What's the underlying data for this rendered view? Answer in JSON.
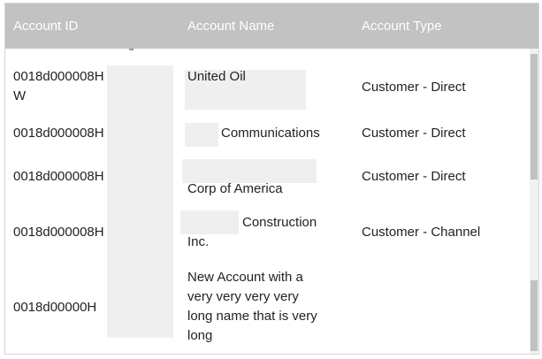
{
  "table": {
    "columns": [
      "Account ID",
      "Account Name",
      "Account Type"
    ],
    "rows": [
      {
        "id": "0018d000008HW",
        "name": "United Oil",
        "type": "Customer - Direct"
      },
      {
        "id": "0018d000008H",
        "name": "Communications",
        "type": "Customer - Direct"
      },
      {
        "id": "0018d000008H",
        "name": "Corp of America",
        "type": "Customer - Direct"
      },
      {
        "id": "0018d000008H",
        "name": "Construction Inc.",
        "type": "Customer - Channel"
      },
      {
        "id": "0018d00000H",
        "name": "New Account with a very very very very long name that is very long",
        "type": ""
      }
    ]
  }
}
